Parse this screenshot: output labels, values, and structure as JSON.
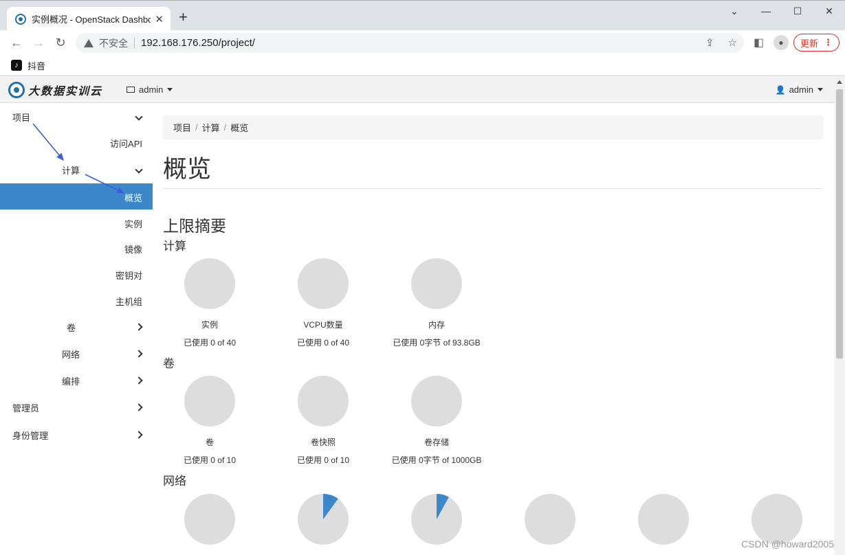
{
  "browser": {
    "tab_title": "实例概况 - OpenStack Dashboard",
    "new_tab": "+",
    "security_label": "不安全",
    "url": "192.168.176.250/project/",
    "update_label": "更新",
    "bookmark_label": "抖音",
    "window_minimize": "—",
    "window_maximize": "☐",
    "window_close": "✕",
    "tab_search": "⌄"
  },
  "header": {
    "logo_text": "大数据实训云",
    "project": "admin",
    "user": "admin"
  },
  "sidebar": {
    "project": "项目",
    "access_api": "访问API",
    "compute": "计算",
    "overview": "概览",
    "instances": "实例",
    "images": "镜像",
    "keypairs": "密钥对",
    "host_groups": "主机组",
    "volumes": "卷",
    "network": "网络",
    "orchestration": "编排",
    "admin": "管理员",
    "identity": "身份管理"
  },
  "breadcrumb": [
    "项目",
    "计算",
    "概览"
  ],
  "page_title": "概览",
  "limits_title": "上限摘要",
  "sections": {
    "compute": "计算",
    "volume": "卷",
    "network": "网络"
  },
  "charts": {
    "compute": [
      {
        "name": "实例",
        "usage": "已使用 0 of 40",
        "fraction": 0
      },
      {
        "name": "VCPU数量",
        "usage": "已使用 0 of 40",
        "fraction": 0
      },
      {
        "name": "内存",
        "usage": "已使用 0字节 of 93.8GB",
        "fraction": 0
      }
    ],
    "volume": [
      {
        "name": "卷",
        "usage": "已使用 0 of 10",
        "fraction": 0
      },
      {
        "name": "卷快照",
        "usage": "已使用 0 of 10",
        "fraction": 0
      },
      {
        "name": "卷存储",
        "usage": "已使用 0字节 of 1000GB",
        "fraction": 0
      }
    ],
    "network": [
      {
        "fraction": 0
      },
      {
        "fraction": 0.1
      },
      {
        "fraction": 0.08
      },
      {
        "fraction": 0
      },
      {
        "fraction": 0
      },
      {
        "fraction": 0
      }
    ]
  },
  "colors": {
    "pie_empty": "#dddddd",
    "pie_used": "#3b87c9",
    "active": "#3b87c9",
    "annotation_arrow": "#3a5fd8"
  },
  "watermark": "CSDN @howard2005"
}
